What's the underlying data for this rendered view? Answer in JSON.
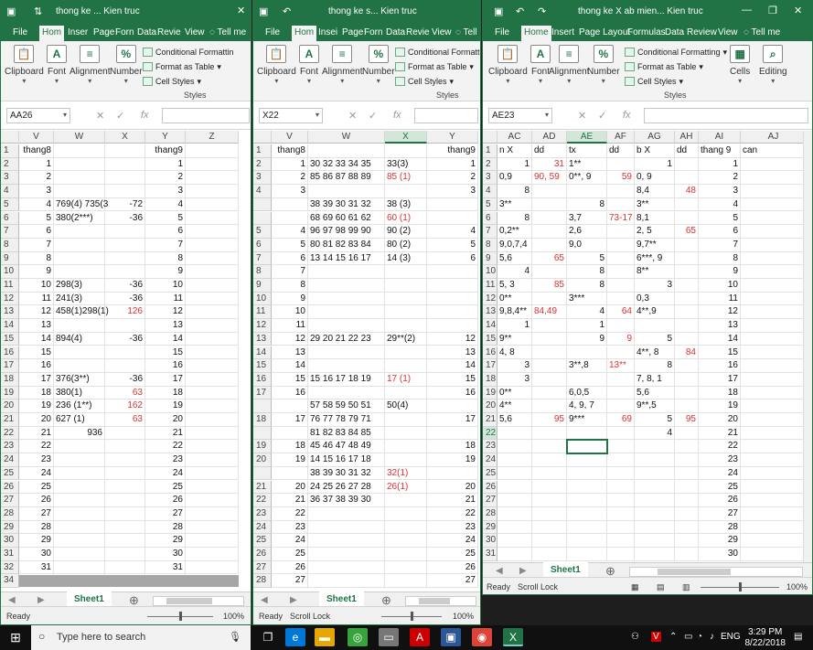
{
  "windows": [
    {
      "id": "w1",
      "title": "thong ke ...  Kien truc",
      "tabs": [
        "File",
        "Hom",
        "Inser",
        "Page",
        "Forn",
        "Data",
        "Revie",
        "View"
      ],
      "tell_me": "Tell me",
      "ribbon": {
        "clipboard": "Clipboard",
        "font": "Font",
        "alignment": "Alignment",
        "number": "Number",
        "cond_fmt": "Conditional Formattin",
        "fmt_table": "Format as Table",
        "cell_styles": "Cell Styles",
        "styles": "Styles"
      },
      "namebox": "AA26",
      "columns": [
        "V",
        "W",
        "X",
        "Y",
        "Z"
      ],
      "sheet_tab": "Sheet1",
      "status": "Ready",
      "zoom": "100%"
    },
    {
      "id": "w2",
      "title": "thong ke s...  Kien truc",
      "tabs": [
        "File",
        "Hom",
        "Insei",
        "Page",
        "Forn",
        "Data",
        "Revie",
        "View"
      ],
      "tell_me": "Tell me",
      "ribbon": {
        "clipboard": "Clipboard",
        "font": "Font",
        "alignment": "Alignment",
        "number": "Number",
        "cond_fmt": "Conditional Formattin",
        "fmt_table": "Format as Table",
        "cell_styles": "Cell Styles",
        "styles": "Styles"
      },
      "namebox": "X22",
      "columns": [
        "V",
        "W",
        "X",
        "Y"
      ],
      "sheet_tab": "Sheet1",
      "status": "Ready",
      "status2": "Scroll Lock",
      "zoom": "100%"
    },
    {
      "id": "w3",
      "title": "thong ke X ab mien...  Kien truc",
      "tabs": [
        "File",
        "Home",
        "Insert",
        "Page Layout",
        "Formulas",
        "Data",
        "Review",
        "View"
      ],
      "tell_me": "Tell me",
      "ribbon": {
        "clipboard": "Clipboard",
        "font": "Font",
        "alignment": "Alignment",
        "number": "Number",
        "cond_fmt": "Conditional Formatting",
        "fmt_table": "Format as Table",
        "cell_styles": "Cell Styles",
        "styles": "Styles",
        "cells": "Cells",
        "editing": "Editing"
      },
      "namebox": "AE23",
      "columns": [
        "AC",
        "AD",
        "AE",
        "AF",
        "AG",
        "AH",
        "AI",
        "AJ"
      ],
      "sheet_tab": "Sheet1",
      "status": "Ready",
      "status2": "Scroll Lock",
      "zoom": "100%"
    }
  ],
  "sheet1": [
    [
      "1",
      "thang8",
      "",
      "",
      "thang9",
      ""
    ],
    [
      "2",
      "1",
      "",
      "",
      "1",
      ""
    ],
    [
      "3",
      "2",
      "",
      "",
      "2",
      ""
    ],
    [
      "4",
      "3",
      "",
      "",
      "3",
      ""
    ],
    [
      "5",
      "4",
      "769(4) 735(3",
      "-72",
      "4",
      ""
    ],
    [
      "6",
      "5",
      "380(2***)",
      "-36",
      "5",
      ""
    ],
    [
      "7",
      "6",
      "",
      "",
      "6",
      ""
    ],
    [
      "8",
      "7",
      "",
      "",
      "7",
      ""
    ],
    [
      "9",
      "8",
      "",
      "",
      "8",
      ""
    ],
    [
      "10",
      "9",
      "",
      "",
      "9",
      ""
    ],
    [
      "11",
      "10",
      "298(3)",
      "-36",
      "10",
      ""
    ],
    [
      "12",
      "11",
      "241(3)",
      "-36",
      "11",
      ""
    ],
    [
      "13",
      "12",
      "458(1)298(1)",
      "126",
      "12",
      ""
    ],
    [
      "14",
      "13",
      "",
      "",
      "13",
      ""
    ],
    [
      "15",
      "14",
      "894(4)",
      "-36",
      "14",
      ""
    ],
    [
      "16",
      "15",
      "",
      "",
      "15",
      ""
    ],
    [
      "17",
      "16",
      "",
      "",
      "16",
      ""
    ],
    [
      "18",
      "17",
      "376(3**)",
      "-36",
      "17",
      ""
    ],
    [
      "19",
      "18",
      "380(1)",
      "63",
      "18",
      ""
    ],
    [
      "20",
      "19",
      "236 (1**)",
      "162",
      "19",
      ""
    ],
    [
      "21",
      "20",
      "627 (1)",
      "63",
      "20",
      ""
    ],
    [
      "22",
      "21",
      "936",
      "",
      "21",
      ""
    ],
    [
      "23",
      "22",
      "",
      "",
      "22",
      ""
    ],
    [
      "24",
      "23",
      "",
      "",
      "23",
      ""
    ],
    [
      "25",
      "24",
      "",
      "",
      "24",
      ""
    ],
    [
      "26",
      "25",
      "",
      "",
      "25",
      ""
    ],
    [
      "27",
      "26",
      "",
      "",
      "26",
      ""
    ],
    [
      "28",
      "27",
      "",
      "",
      "27",
      ""
    ],
    [
      "29",
      "28",
      "",
      "",
      "28",
      ""
    ],
    [
      "30",
      "29",
      "",
      "",
      "29",
      ""
    ],
    [
      "31",
      "30",
      "",
      "",
      "30",
      ""
    ],
    [
      "32",
      "31",
      "",
      "",
      "31",
      ""
    ],
    [
      "34",
      "",
      "",
      "",
      "",
      ""
    ],
    [
      "35",
      "",
      "",
      "",
      "",
      ""
    ]
  ],
  "sheet1_red_x": [
    "126",
    "63",
    "162"
  ],
  "sheet2": [
    [
      "1",
      "thang8",
      "",
      "",
      "thang9"
    ],
    [
      "2",
      "1",
      "30 32 33 34 35",
      "33(3)",
      "1"
    ],
    [
      "3",
      "2",
      "85 86 87 88 89",
      "85 (1)",
      "2"
    ],
    [
      "4",
      "3",
      "",
      "",
      "3"
    ],
    [
      "",
      "",
      "38 39 30 31 32",
      "38 (3)",
      ""
    ],
    [
      "",
      "",
      "68 69 60 61 62",
      "60 (1)",
      ""
    ],
    [
      "5",
      "4",
      "96 97 98 99 90",
      "90 (2)",
      "4"
    ],
    [
      "6",
      "5",
      "80 81 82 83 84",
      "80 (2)",
      "5"
    ],
    [
      "7",
      "6",
      "13 14 15 16 17",
      "14 (3)",
      "6"
    ],
    [
      "8",
      "7",
      "",
      "",
      ""
    ],
    [
      "9",
      "8",
      "",
      "",
      ""
    ],
    [
      "10",
      "9",
      "",
      "",
      ""
    ],
    [
      "11",
      "10",
      "",
      "",
      ""
    ],
    [
      "12",
      "11",
      "",
      "",
      ""
    ],
    [
      "13",
      "12",
      "29 20 21 22 23",
      "29**(2)",
      "12"
    ],
    [
      "14",
      "13",
      "",
      "",
      "13"
    ],
    [
      "15",
      "14",
      "",
      "",
      "14"
    ],
    [
      "16",
      "15",
      "15 16 17 18 19",
      "17 (1)",
      "15"
    ],
    [
      "17",
      "16",
      "",
      "",
      "16"
    ],
    [
      "",
      "",
      "57 58 59 50 51",
      "50(4)",
      ""
    ],
    [
      "18",
      "17",
      "76 77 78 79 71",
      "",
      "17"
    ],
    [
      "",
      "",
      "81 82 83 84 85",
      "",
      ""
    ],
    [
      "19",
      "18",
      "45 46 47 48 49",
      "",
      "18"
    ],
    [
      "20",
      "19",
      "14 15 16 17 18",
      "",
      "19"
    ],
    [
      "",
      "",
      "38 39 30 31 32",
      "32(1)",
      ""
    ],
    [
      "21",
      "20",
      "24 25 26 27 28",
      "26(1)",
      "20"
    ],
    [
      "22",
      "21",
      "36 37 38 39 30",
      "",
      "21"
    ],
    [
      "23",
      "22",
      "",
      "",
      "22"
    ],
    [
      "24",
      "23",
      "",
      "",
      "23"
    ],
    [
      "25",
      "24",
      "",
      "",
      "24"
    ],
    [
      "26",
      "25",
      "",
      "",
      "25"
    ],
    [
      "27",
      "26",
      "",
      "",
      "26"
    ],
    [
      "28",
      "27",
      "",
      "",
      "27"
    ],
    [
      "29",
      "28",
      "",
      "",
      "28"
    ],
    [
      "30",
      "29",
      "",
      "",
      "29"
    ],
    [
      "31",
      "30",
      "",
      "",
      "30"
    ]
  ],
  "sheet2_red_x": [
    "85 (1)",
    "60 (1)",
    "17 (1)",
    "32(1)",
    "26(1)"
  ],
  "sheet3": [
    [
      "1",
      "n X",
      "dd",
      "tx",
      "dd",
      "b X",
      "dd",
      "thang 9",
      "can"
    ],
    [
      "2",
      "1",
      "31",
      "1**",
      "",
      "1",
      "",
      "1",
      ""
    ],
    [
      "3",
      "0,9",
      "90, 59",
      "0**, 9",
      "59",
      "0, 9",
      "",
      "2",
      ""
    ],
    [
      "4",
      "8",
      "",
      "",
      "",
      "8,4",
      "48",
      "3",
      ""
    ],
    [
      "5",
      "3**",
      "",
      "8",
      "",
      "3**",
      "",
      "4",
      ""
    ],
    [
      "6",
      "8",
      "",
      "3,7",
      "73-17",
      "8,1",
      "",
      "5",
      ""
    ],
    [
      "7",
      "0,2**",
      "",
      "2,6",
      "",
      "2, 5",
      "65",
      "6",
      ""
    ],
    [
      "8",
      "9,0,7,4",
      "",
      "9,0",
      "",
      "9,7**",
      "",
      "7",
      ""
    ],
    [
      "9",
      "5,6",
      "65",
      "5",
      "",
      "6***, 9",
      "",
      "8",
      ""
    ],
    [
      "10",
      "4",
      "",
      "8",
      "",
      "8**",
      "",
      "9",
      ""
    ],
    [
      "11",
      "5, 3",
      "85",
      "8",
      "",
      "3",
      "",
      "10",
      ""
    ],
    [
      "12",
      "0**",
      "",
      "3***",
      "",
      "0,3",
      "",
      "11",
      ""
    ],
    [
      "13",
      "9,8,4**",
      "84,49",
      "4",
      "64",
      "4**,9",
      "",
      "12",
      ""
    ],
    [
      "14",
      "1",
      "",
      "1",
      "",
      "",
      "",
      "13",
      ""
    ],
    [
      "15",
      "9**",
      "",
      "9",
      "9",
      "5",
      "",
      "14",
      ""
    ],
    [
      "16",
      "4, 8",
      "",
      "",
      "",
      "4**, 8",
      "84",
      "15",
      ""
    ],
    [
      "17",
      "3",
      "",
      "3**,8",
      "13**",
      "8",
      "",
      "16",
      ""
    ],
    [
      "18",
      "3",
      "",
      "",
      "",
      "7, 8, 1",
      "",
      "17",
      ""
    ],
    [
      "19",
      "0**",
      "",
      "6,0,5",
      "",
      "5,6",
      "",
      "18",
      ""
    ],
    [
      "20",
      "4**",
      "",
      "4, 9, 7",
      "",
      "9**,5",
      "",
      "19",
      ""
    ],
    [
      "21",
      "5,6",
      "95",
      "9***",
      "69",
      "5",
      "95",
      "20",
      ""
    ],
    [
      "22",
      "",
      "",
      "",
      "",
      "4",
      "",
      "21",
      ""
    ],
    [
      "23",
      "",
      "",
      "",
      "",
      "",
      "",
      "22",
      ""
    ],
    [
      "24",
      "",
      "",
      "",
      "",
      "",
      "",
      "23",
      ""
    ],
    [
      "25",
      "",
      "",
      "",
      "",
      "",
      "",
      "24",
      ""
    ],
    [
      "26",
      "",
      "",
      "",
      "",
      "",
      "",
      "25",
      ""
    ],
    [
      "27",
      "",
      "",
      "",
      "",
      "",
      "",
      "26",
      ""
    ],
    [
      "28",
      "",
      "",
      "",
      "",
      "",
      "",
      "27",
      ""
    ],
    [
      "29",
      "",
      "",
      "",
      "",
      "",
      "",
      "28",
      ""
    ],
    [
      "30",
      "",
      "",
      "",
      "",
      "",
      "",
      "29",
      ""
    ],
    [
      "31",
      "",
      "",
      "",
      "",
      "",
      "",
      "30",
      ""
    ],
    [
      "32",
      "",
      "",
      "",
      "",
      "",
      "",
      "31",
      ""
    ]
  ],
  "taskbar": {
    "search_placeholder": "Type here to search",
    "time": "3:29 PM",
    "date": "8/22/2018",
    "lang": "ENG"
  },
  "colors": {
    "excel_green": "#217346",
    "red_text": "#e03030"
  }
}
